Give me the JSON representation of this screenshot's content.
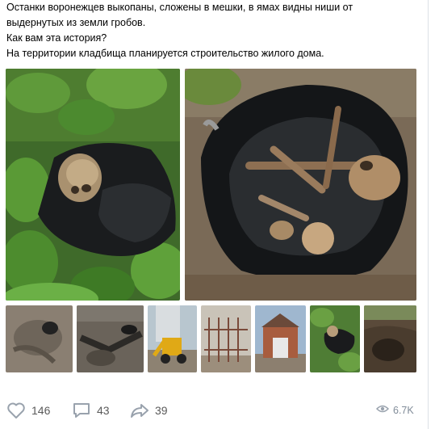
{
  "post": {
    "text_line_1": "Останки воронежцев выкопаны, сложены в мешки, в ямах видны ниши от",
    "text_line_2": "выдернутых из земли гробов.",
    "text_line_3": "Как вам эта история?",
    "text_line_4": "На территории кладбища планируется строительство жилого дома."
  },
  "photos": {
    "main": [
      {
        "name": "skull-in-bushes-photo"
      },
      {
        "name": "bones-in-bag-photo"
      }
    ],
    "thumbnails": [
      {
        "name": "pit-with-niche-photo"
      },
      {
        "name": "excavated-ground-photo"
      },
      {
        "name": "excavator-photo"
      },
      {
        "name": "fence-photo"
      },
      {
        "name": "chapel-photo"
      },
      {
        "name": "bag-in-grass-photo"
      },
      {
        "name": "dug-pit-photo"
      }
    ]
  },
  "actions": {
    "likes": "146",
    "comments": "43",
    "shares": "39",
    "views": "6.7K"
  },
  "colors": {
    "icon": "#99a2ad",
    "count_text": "#5a5a5a",
    "views_text": "#818c99"
  }
}
